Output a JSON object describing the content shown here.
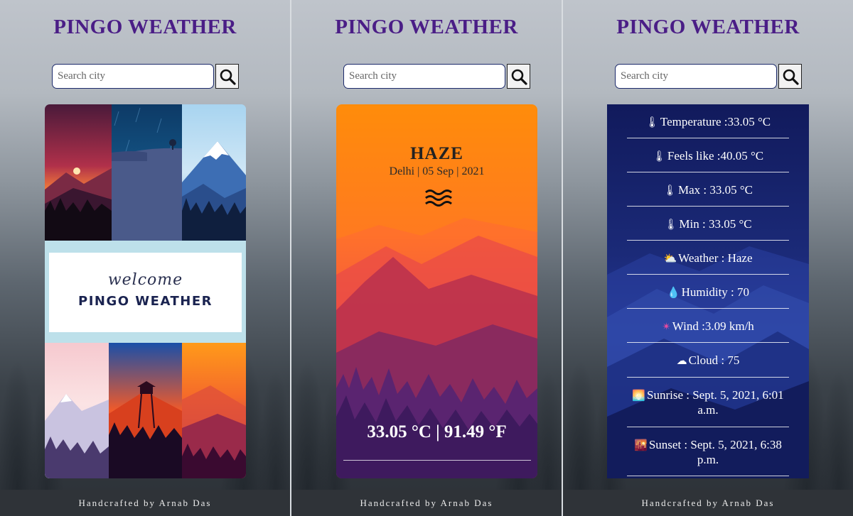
{
  "app_title": "PINGO WEATHER",
  "search": {
    "placeholder": "Search city"
  },
  "footer": "Handcrafted by Arnab Das",
  "welcome": {
    "script": "welcome",
    "brand": "PINGO WEATHER"
  },
  "weather": {
    "condition": "HAZE",
    "location_date": "Delhi | 05 Sep | 2021",
    "temperature": "33.05 °C | 91.49 °F"
  },
  "details": [
    {
      "icon": "thermometer-icon",
      "emoji": "🌡",
      "text": "Temperature :33.05 °C"
    },
    {
      "icon": "thermometer-icon",
      "emoji": "🌡",
      "text": "Feels like :40.05 °C"
    },
    {
      "icon": "hot-thermometer-icon",
      "emoji": "🌡",
      "text": "Max : 33.05 °C"
    },
    {
      "icon": "cold-thermometer-icon",
      "emoji": "🌡",
      "text": "Min : 33.05 °C"
    },
    {
      "icon": "sun-behind-cloud-icon",
      "emoji": "⛅",
      "text": "Weather : Haze"
    },
    {
      "icon": "droplet-icon",
      "emoji": "💧",
      "text": "Humidity : 70"
    },
    {
      "icon": "pinwheel-icon",
      "emoji": "✴",
      "text": "Wind :3.09 km/h"
    },
    {
      "icon": "cloud-icon",
      "emoji": "☁",
      "text": "Cloud : 75"
    },
    {
      "icon": "sunrise-icon",
      "emoji": "🌅",
      "text": "Sunrise : Sept. 5, 2021, 6:01 a.m."
    },
    {
      "icon": "sunset-icon",
      "emoji": "🌇",
      "text": "Sunset : Sept. 5, 2021, 6:38 p.m."
    }
  ],
  "colors": {
    "title": "#4a1d86",
    "footer_bg": "#2f3338",
    "card_navy": "#1b2a78",
    "haze_orange": "#ff8a0a"
  }
}
